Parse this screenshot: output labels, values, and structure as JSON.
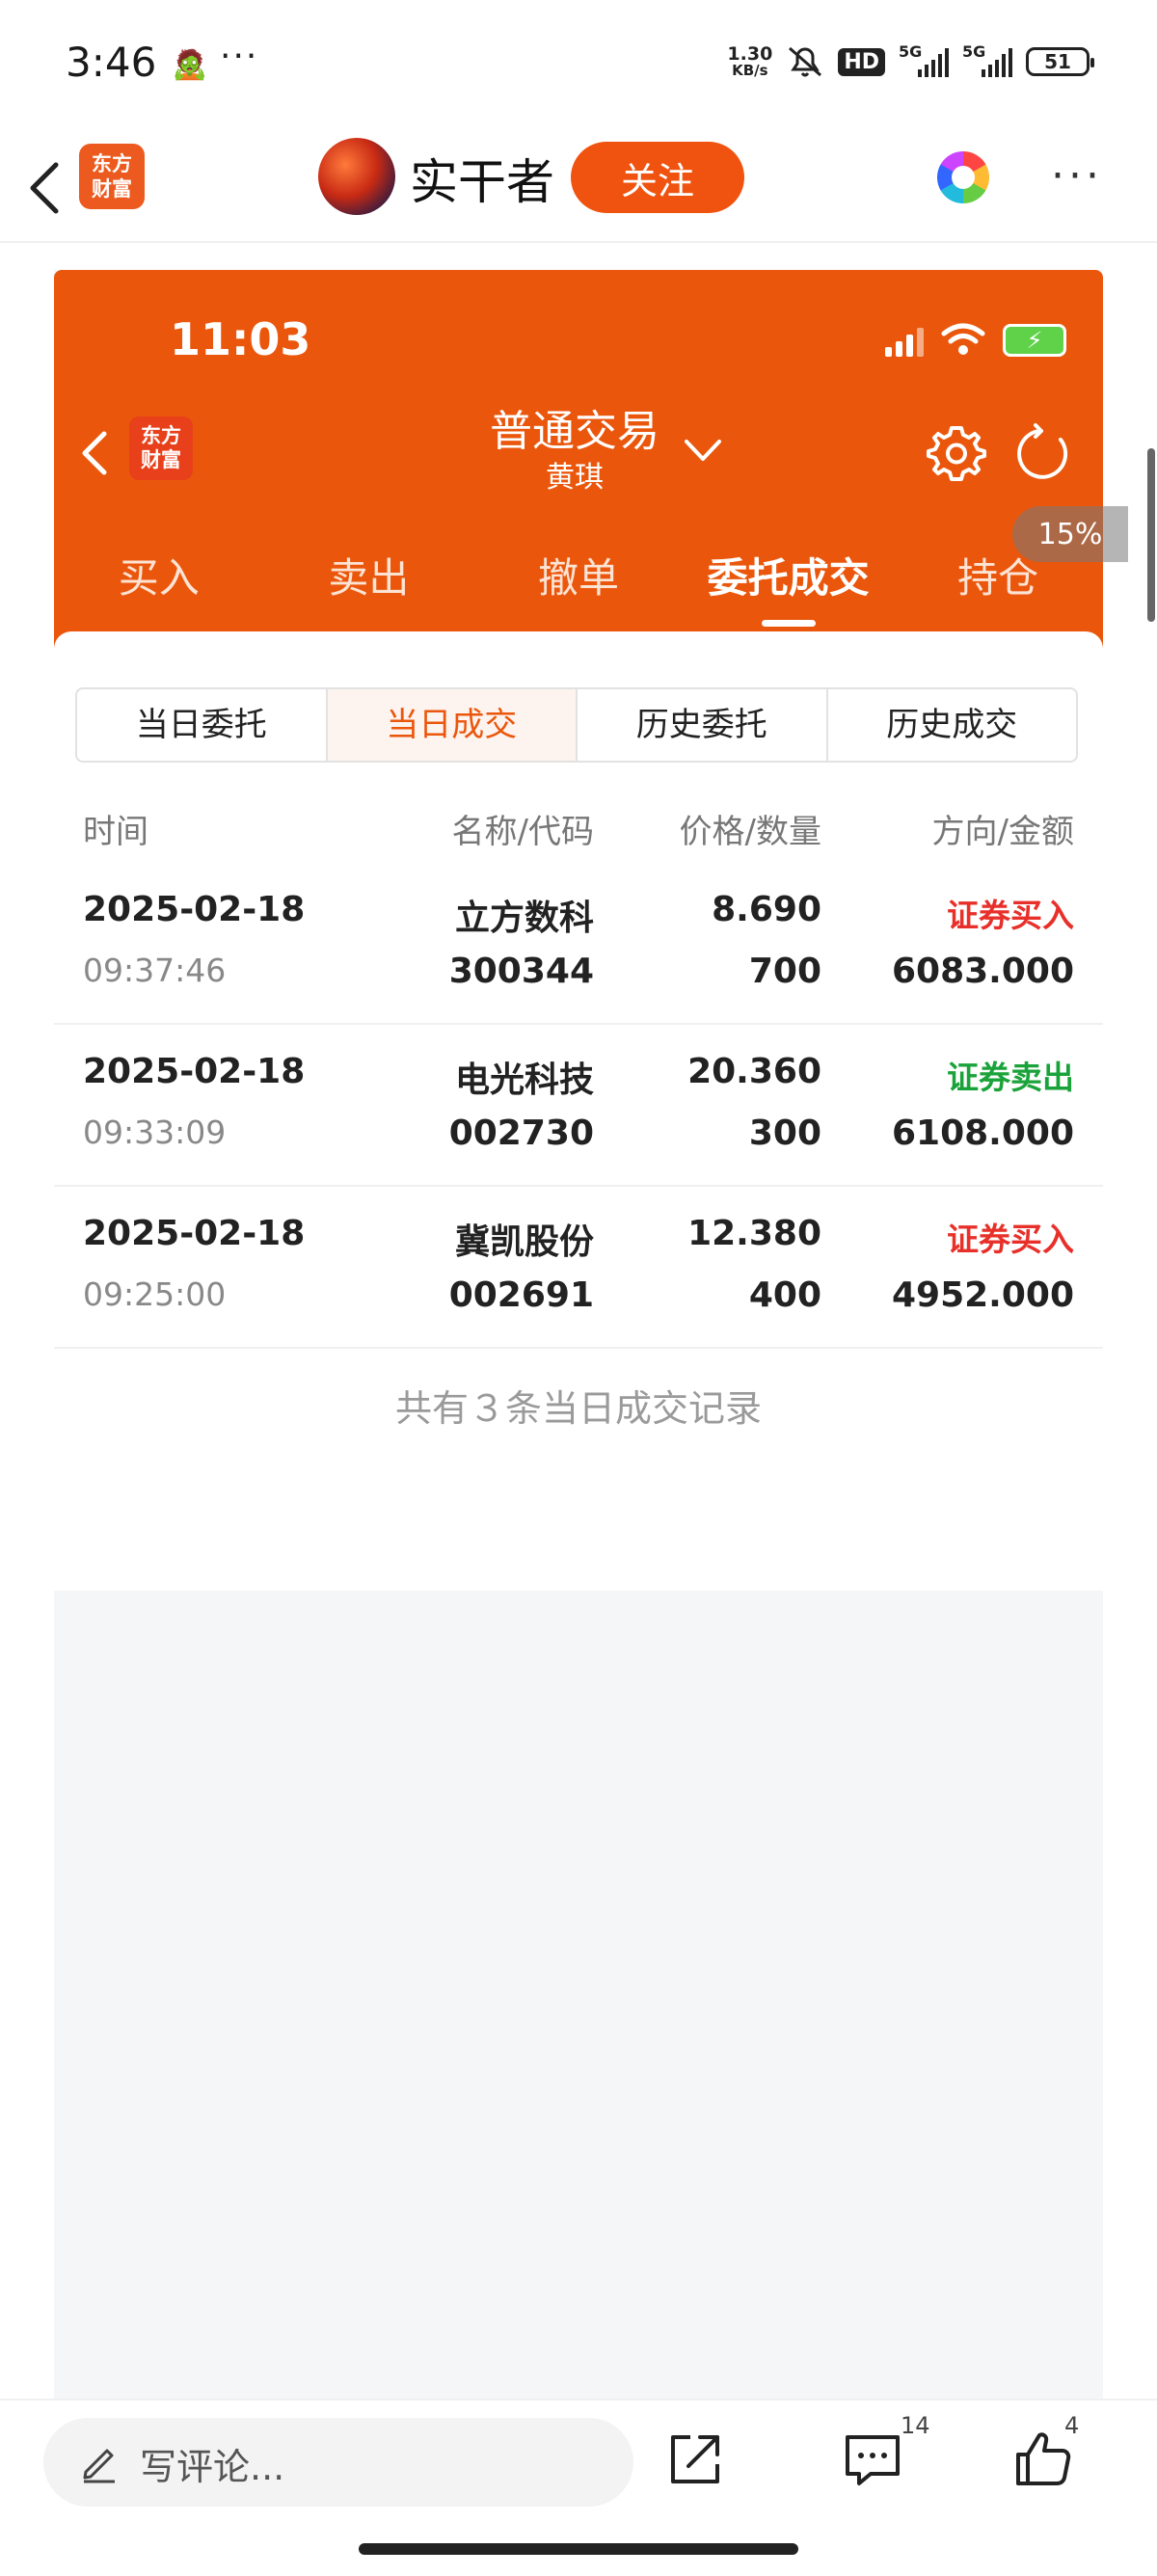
{
  "system_status": {
    "time": "3:46",
    "emoji": "🧟",
    "dots": "···",
    "net_speed_value": "1.30",
    "net_speed_unit": "KB/s",
    "hd": "HD",
    "sim1": "5G",
    "sim2": "5G",
    "battery": "51"
  },
  "article_header": {
    "brand_line1": "东方",
    "brand_line2": "财富",
    "author": "实干者",
    "follow_label": "关注"
  },
  "embedded": {
    "status_time": "11:03",
    "brand_line1": "东方",
    "brand_line2": "财富",
    "title": "普通交易",
    "subtitle": "黄琪",
    "tabs": [
      {
        "label": "买入"
      },
      {
        "label": "卖出"
      },
      {
        "label": "撤单"
      },
      {
        "label": "委托成交"
      },
      {
        "label": "持仓"
      }
    ],
    "percent_badge": "15%",
    "subtabs": [
      {
        "label": "当日委托"
      },
      {
        "label": "当日成交"
      },
      {
        "label": "历史委托"
      },
      {
        "label": "历史成交"
      }
    ],
    "columns": [
      "时间",
      "名称/代码",
      "价格/数量",
      "方向/金额"
    ],
    "trades": [
      {
        "date": "2025-02-18",
        "time": "09:37:46",
        "name": "立方数科",
        "code": "300344",
        "price": "8.690",
        "qty": "700",
        "direction": "证券买入",
        "amount": "6083.000"
      },
      {
        "date": "2025-02-18",
        "time": "09:33:09",
        "name": "电光科技",
        "code": "002730",
        "price": "20.360",
        "qty": "300",
        "direction": "证券卖出",
        "amount": "6108.000"
      },
      {
        "date": "2025-02-18",
        "time": "09:25:00",
        "name": "冀凯股份",
        "code": "002691",
        "price": "12.380",
        "qty": "400",
        "direction": "证券买入",
        "amount": "4952.000"
      }
    ],
    "summary": "共有３条当日成交记录"
  },
  "bottom_bar": {
    "comment_placeholder": "写评论...",
    "comment_count": "14",
    "like_count": "4"
  },
  "colors": {
    "brand_orange": "#ea570c",
    "buy_red": "#e8302a",
    "sell_green": "#1aa33a"
  },
  "icons": [
    "back-arrow-icon",
    "color-wheel-icon",
    "more-icon",
    "chevron-down-icon",
    "gear-icon",
    "refresh-icon",
    "pencil-icon",
    "share-icon",
    "comment-icon",
    "like-icon"
  ]
}
